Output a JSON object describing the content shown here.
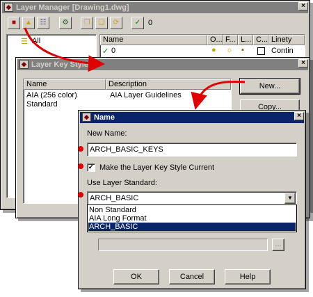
{
  "layer_manager": {
    "title": "Layer Manager [Drawing1.dwg]",
    "toolbar_count": "0",
    "tree_root": "All",
    "columns": [
      "Name",
      "O...",
      "F...",
      "L...",
      "C...",
      "Linety"
    ],
    "row": {
      "name": "0",
      "linetype": "Contin"
    },
    "icons": [
      "layer-state-icon",
      "new-layer-icon",
      "layer-key-styles-icon",
      "layer-filter-icon",
      "copy-icon",
      "paste-icon",
      "refresh-icon",
      "checkmark-icon"
    ]
  },
  "layer_key_styles": {
    "title": "Layer Key Styles",
    "columns": [
      "Name",
      "Description"
    ],
    "rows": [
      {
        "name": "AIA (256 color)",
        "description": "AIA Layer Guidelines"
      },
      {
        "name": "Standard",
        "description": ""
      }
    ],
    "new_button": "New...",
    "copy_button": "Copy..."
  },
  "name_dialog": {
    "title": "Name",
    "new_name_label": "New Name:",
    "new_name_value": "ARCH_BASIC_KEYS",
    "current_checkbox_label": "Make the Layer Key Style Current",
    "current_checked": true,
    "standard_label": "Use Layer Standard:",
    "standard_value": "ARCH_BASIC",
    "standard_options": [
      "Non Standard",
      "AIA Long Format",
      "ARCH_BASIC"
    ],
    "selected_option": "ARCH_BASIC",
    "browse_button": "...",
    "ok_button": "OK",
    "cancel_button": "Cancel",
    "help_button": "Help"
  },
  "colors": {
    "active_title": "#0a246a",
    "inactive_title": "#808080",
    "annotation_red": "#e00000",
    "face": "#d4d0c8"
  }
}
